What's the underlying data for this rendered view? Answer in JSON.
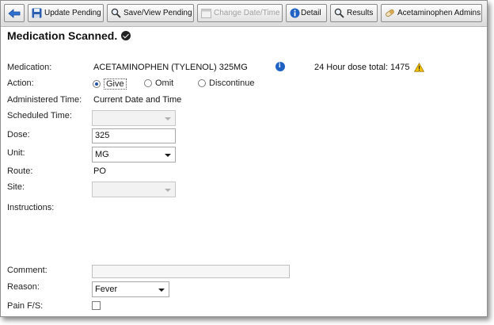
{
  "toolbar": {
    "buttons": [
      {
        "label": "",
        "icon": "back-arrow-icon",
        "enabled": true
      },
      {
        "label": "Update Pending",
        "icon": "save-disk-icon",
        "enabled": true
      },
      {
        "label": "Save/View Pending",
        "icon": "search-magnifier-icon",
        "enabled": true
      },
      {
        "label": "Change Date/Time",
        "icon": "calendar-icon",
        "enabled": false
      },
      {
        "label": "Detail",
        "icon": "info-icon",
        "enabled": true
      },
      {
        "label": "Results",
        "icon": "search-magnifier-icon",
        "enabled": true
      },
      {
        "label": "Acetaminophen Admins",
        "icon": "pill-icon",
        "enabled": true
      }
    ]
  },
  "header": {
    "title": "Medication Scanned."
  },
  "form": {
    "medication_label": "Medication:",
    "medication_value": "ACETAMINOPHEN (TYLENOL)  325MG",
    "dose_total": "24 Hour dose total: 1475",
    "action_label": "Action:",
    "actions": [
      "Give",
      "Omit",
      "Discontinue"
    ],
    "action_selected": "Give",
    "administered_label": "Administered Time:",
    "administered_value": "Current Date and Time",
    "scheduled_label": "Scheduled Time:",
    "dose_label": "Dose:",
    "dose_value": "325",
    "unit_label": "Unit:",
    "unit_value": "MG",
    "route_label": "Route:",
    "route_value": "PO",
    "site_label": "Site:",
    "instructions_label": "Instructions:",
    "comment_label": "Comment:",
    "reason_label": "Reason:",
    "reason_value": "Fever",
    "pain_label": "Pain F/S:"
  },
  "colors": {
    "accent": "#1f62c4",
    "warning": "#e8b400"
  }
}
